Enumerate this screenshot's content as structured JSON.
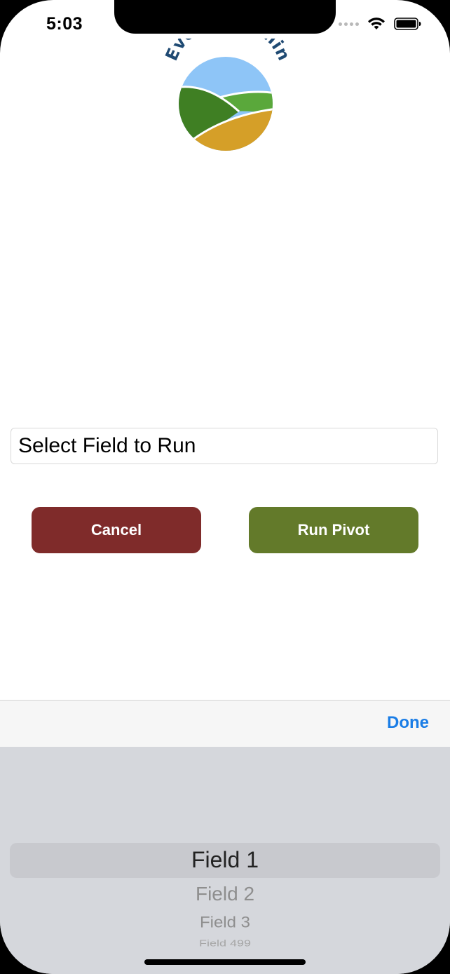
{
  "status_bar": {
    "time": "5:03"
  },
  "logo": {
    "text": "EvenStreamin",
    "colors": {
      "text": "#1f4a73",
      "sky": "#8ec5f7",
      "dark_green": "#3f7f23",
      "light_green": "#5aa83b",
      "gold": "#d59f28"
    }
  },
  "form": {
    "field_placeholder": "Select Field to Run",
    "cancel_label": "Cancel",
    "run_label": "Run Pivot"
  },
  "toolbar": {
    "done_label": "Done"
  },
  "picker": {
    "options": [
      "Field 1",
      "Field 2",
      "Field 3",
      "Field 499"
    ],
    "selected": "Field 1"
  },
  "colors": {
    "cancel": "#7f2b2a",
    "run": "#637a2a",
    "done": "#1a7de6"
  }
}
